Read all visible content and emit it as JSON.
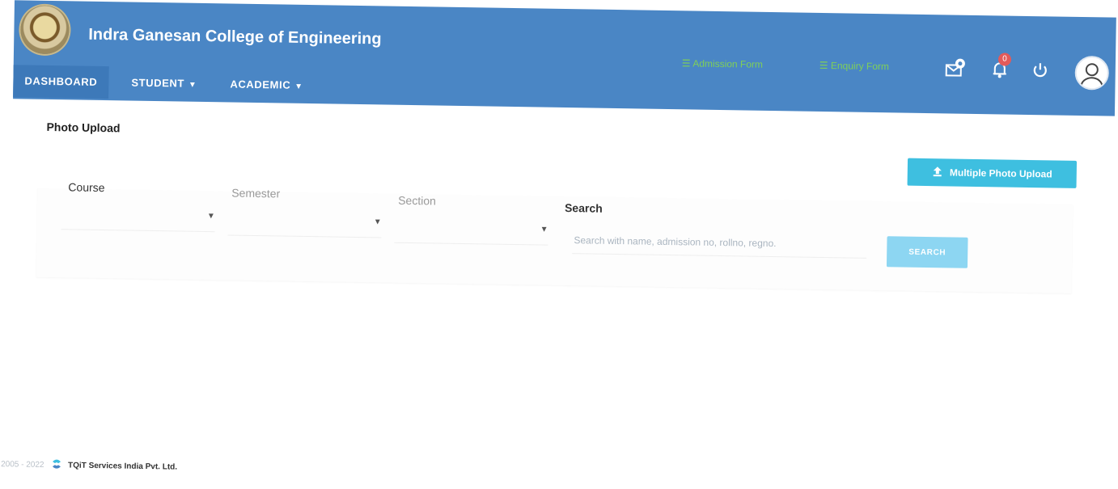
{
  "app": {
    "college_name": "Indra Ganesan College of Engineering"
  },
  "nav": {
    "items": [
      {
        "label": "DASHBOARD",
        "has_caret": false
      },
      {
        "label": "STUDENT",
        "has_caret": true
      },
      {
        "label": "ACADEMIC",
        "has_caret": true
      }
    ]
  },
  "header": {
    "portal_links": [
      {
        "label": "Admission Form",
        "icon": "list-icon"
      },
      {
        "label": "Enquiry Form",
        "icon": "list-icon"
      }
    ],
    "notification_count": "0",
    "icons": [
      "mail-settings-icon",
      "bell-icon",
      "power-icon",
      "avatar-icon"
    ]
  },
  "page": {
    "title": "Photo Upload",
    "multi_upload_label": "Multiple Photo Upload"
  },
  "filters": {
    "course_label": "Course",
    "semester_label": "Semester",
    "section_label": "Section",
    "search_label": "Search",
    "search_placeholder": "Search with name, admission no, rollno, regno.",
    "search_button": "SEARCH"
  },
  "footer": {
    "copyright": "© 2005 - 2022",
    "company": "TQiT Services India Pvt. Ltd."
  },
  "colors": {
    "header_bg": "#4a86c5",
    "accent_button": "#3ebfe0",
    "search_button": "#8dd6f2",
    "portal_link": "#7fcf59",
    "badge": "#e35a5a"
  }
}
